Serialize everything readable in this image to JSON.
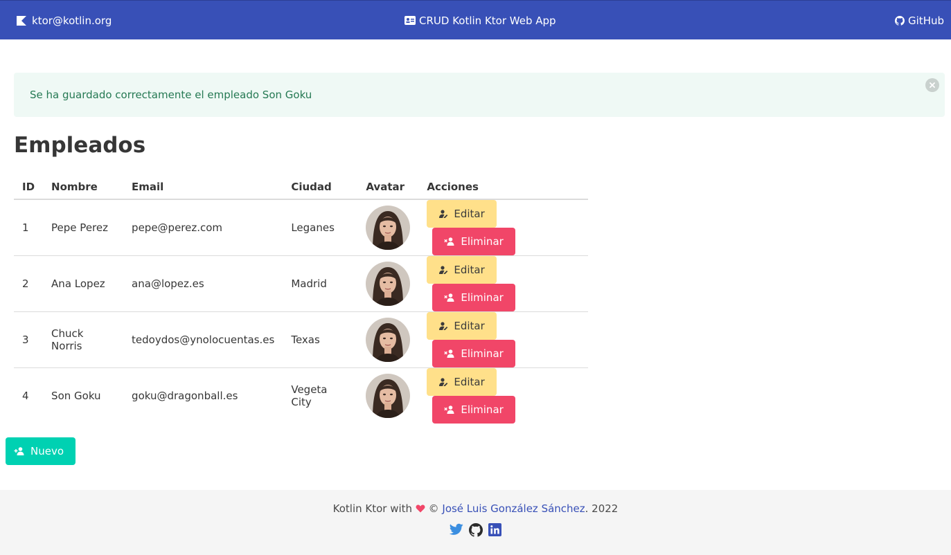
{
  "navbar": {
    "brand": "ktor@kotlin.org",
    "brand_icon": "kotlin-logo-icon",
    "center": "CRUD Kotlin Ktor Web App",
    "center_icon": "id-card-icon",
    "github": "GitHub",
    "github_icon": "github-icon"
  },
  "notification": {
    "message": "Se ha guardado correctamente el empleado Son Goku",
    "close_icon": "close-icon"
  },
  "page": {
    "title": "Empleados"
  },
  "table": {
    "headers": [
      "ID",
      "Nombre",
      "Email",
      "Ciudad",
      "Avatar",
      "Acciones"
    ],
    "rows": [
      {
        "id": "1",
        "nombre": "Pepe Perez",
        "email": "pepe@perez.com",
        "ciudad": "Leganes"
      },
      {
        "id": "2",
        "nombre": "Ana Lopez",
        "email": "ana@lopez.es",
        "ciudad": "Madrid"
      },
      {
        "id": "3",
        "nombre": "Chuck Norris",
        "email": "tedoydos@ynolocuentas.es",
        "ciudad": "Texas"
      },
      {
        "id": "4",
        "nombre": "Son Goku",
        "email": "goku@dragonball.es",
        "ciudad": "Vegeta City"
      }
    ],
    "edit_label": "Editar",
    "delete_label": "Eliminar"
  },
  "actions": {
    "new_label": "Nuevo"
  },
  "footer": {
    "prefix": "Kotlin Ktor with",
    "copyright": "©",
    "author": "José Luis González Sánchez",
    "year": ". 2022",
    "icons": [
      "twitter-icon",
      "github-icon",
      "linkedin-icon"
    ]
  },
  "colors": {
    "navbar": "#3850b7",
    "success_bg": "#eff9f5",
    "success_text": "#257953",
    "warning": "#ffe08a",
    "danger": "#f14668",
    "primary": "#00d1b2",
    "footer_bg": "#f5f5f5"
  }
}
